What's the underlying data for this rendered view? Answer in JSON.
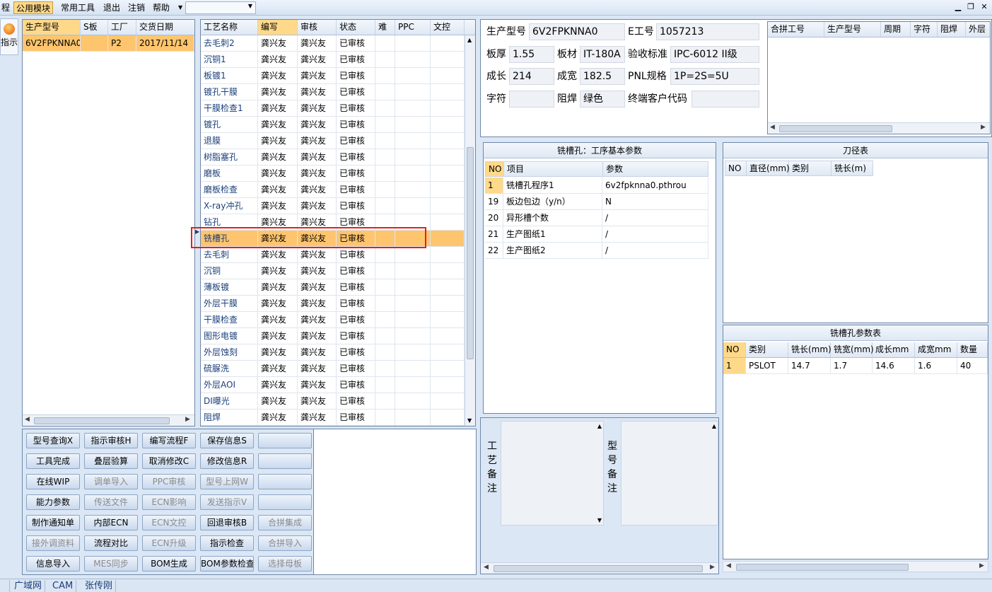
{
  "menu": {
    "items": [
      "程",
      "公用模块",
      "常用工具",
      "退出",
      "注销",
      "帮助"
    ],
    "active_index": 1,
    "dropdown_value": ""
  },
  "left_strip": {
    "label": "指示"
  },
  "model_list": {
    "headers": [
      "生产型号",
      "S板",
      "工厂",
      "交货日期"
    ],
    "rows": [
      [
        "6V2FPKNNA0",
        "",
        "P2",
        "2017/11/14"
      ]
    ]
  },
  "process_list": {
    "headers": [
      "工艺名称",
      "编写",
      "审核",
      "状态",
      "难",
      "PPC",
      "文控"
    ],
    "rows": [
      [
        "去毛刺2",
        "龚兴友",
        "龚兴友",
        "已审核"
      ],
      [
        "沉铜1",
        "龚兴友",
        "龚兴友",
        "已审核"
      ],
      [
        "板镀1",
        "龚兴友",
        "龚兴友",
        "已审核"
      ],
      [
        "镀孔干膜",
        "龚兴友",
        "龚兴友",
        "已审核"
      ],
      [
        "干膜检查1",
        "龚兴友",
        "龚兴友",
        "已审核"
      ],
      [
        "镀孔",
        "龚兴友",
        "龚兴友",
        "已审核"
      ],
      [
        "退膜",
        "龚兴友",
        "龚兴友",
        "已审核"
      ],
      [
        "树脂塞孔",
        "龚兴友",
        "龚兴友",
        "已审核"
      ],
      [
        "磨板",
        "龚兴友",
        "龚兴友",
        "已审核"
      ],
      [
        "磨板检查",
        "龚兴友",
        "龚兴友",
        "已审核"
      ],
      [
        "X-ray冲孔",
        "龚兴友",
        "龚兴友",
        "已审核"
      ],
      [
        "钻孔",
        "龚兴友",
        "龚兴友",
        "已审核"
      ],
      [
        "铣槽孔",
        "龚兴友",
        "龚兴友",
        "已审核"
      ],
      [
        "去毛刺",
        "龚兴友",
        "龚兴友",
        "已审核"
      ],
      [
        "沉铜",
        "龚兴友",
        "龚兴友",
        "已审核"
      ],
      [
        "薄板镀",
        "龚兴友",
        "龚兴友",
        "已审核"
      ],
      [
        "外层干膜",
        "龚兴友",
        "龚兴友",
        "已审核"
      ],
      [
        "干膜检查",
        "龚兴友",
        "龚兴友",
        "已审核"
      ],
      [
        "图形电镀",
        "龚兴友",
        "龚兴友",
        "已审核"
      ],
      [
        "外层蚀刻",
        "龚兴友",
        "龚兴友",
        "已审核"
      ],
      [
        "硫脲洗",
        "龚兴友",
        "龚兴友",
        "已审核"
      ],
      [
        "外层AOI",
        "龚兴友",
        "龚兴友",
        "已审核"
      ],
      [
        "DI曝光",
        "龚兴友",
        "龚兴友",
        "已审核"
      ],
      [
        "阻焊",
        "龚兴友",
        "龚兴友",
        "已审核"
      ]
    ],
    "selected_index": 12
  },
  "buttons": [
    [
      "型号查询X",
      "指示审核H",
      "编写流程F",
      "保存信息S",
      ""
    ],
    [
      "工具完成",
      "叠层验算",
      "取消修改C",
      "修改信息R",
      ""
    ],
    [
      "在线WIP",
      "调单导入",
      "PPC审核",
      "型号上网W",
      ""
    ],
    [
      "能力参数",
      "传送文件",
      "ECN影响",
      "发送指示V",
      ""
    ],
    [
      "制作通知单",
      "内部ECN",
      "ECN文控",
      "回退审核B",
      "合拼集成"
    ],
    [
      "接外调资料",
      "流程对比",
      "ECN升级",
      "指示检查",
      "合拼导入"
    ],
    [
      "信息导入",
      "MES同步",
      "BOM生成",
      "BOM参数检查",
      "选择母板"
    ]
  ],
  "buttons_disabled": [
    [
      false,
      false,
      false,
      false,
      false
    ],
    [
      false,
      false,
      false,
      false,
      false
    ],
    [
      false,
      true,
      true,
      true,
      false
    ],
    [
      false,
      true,
      true,
      true,
      false
    ],
    [
      false,
      false,
      true,
      false,
      true
    ],
    [
      true,
      false,
      true,
      false,
      true
    ],
    [
      false,
      true,
      false,
      false,
      true
    ]
  ],
  "info": {
    "model_label": "生产型号",
    "model_value": "6V2FPKNNA0",
    "e_label": "E工号",
    "e_value": "1057213",
    "thick_label": "板厚",
    "thick_value": "1.55",
    "material_label": "板材",
    "material_value": "IT-180A",
    "std_label": "验收标准",
    "std_value": "IPC-6012 II级",
    "len_label": "成长",
    "len_value": "214",
    "wid_label": "成宽",
    "wid_value": "182.5",
    "pnl_label": "PNL规格",
    "pnl_value": "1P=2S=5U",
    "char_label": "字符",
    "char_value": "",
    "mask_label": "阻焊",
    "mask_value": "绿色",
    "cust_label": "终端客户代码",
    "cust_value": ""
  },
  "merge_table": {
    "headers": [
      "合拼工号",
      "生产型号",
      "周期",
      "字符",
      "阻焊",
      "外层"
    ]
  },
  "params": {
    "title": "铣槽孔：工序基本参数",
    "headers": [
      "NO",
      "项目",
      "参数"
    ],
    "rows": [
      [
        "1",
        "铣槽孔程序1",
        "6v2fpknna0.pthrou"
      ],
      [
        "19",
        "板边包边（y/n）",
        "N"
      ],
      [
        "20",
        "异形槽个数",
        "/"
      ],
      [
        "21",
        "生产图纸1",
        "/"
      ],
      [
        "22",
        "生产图纸2",
        "/"
      ]
    ]
  },
  "tools": {
    "title": "刀径表",
    "headers": [
      "NO",
      "直径(mm)",
      "类别",
      "铣长(m)"
    ]
  },
  "slot_params": {
    "title": "铣槽孔参数表",
    "headers": [
      "NO",
      "类别",
      "铣长(mm)",
      "铣宽(mm)",
      "成长mm",
      "成宽mm",
      "数量"
    ],
    "rows": [
      [
        "1",
        "PSLOT",
        "14.7",
        "1.7",
        "14.6",
        "1.6",
        "40"
      ]
    ]
  },
  "remarks": {
    "process_label": "工艺备注",
    "model_label": "型号备注"
  },
  "status": [
    "广域网",
    "CAM",
    "张传刚"
  ]
}
